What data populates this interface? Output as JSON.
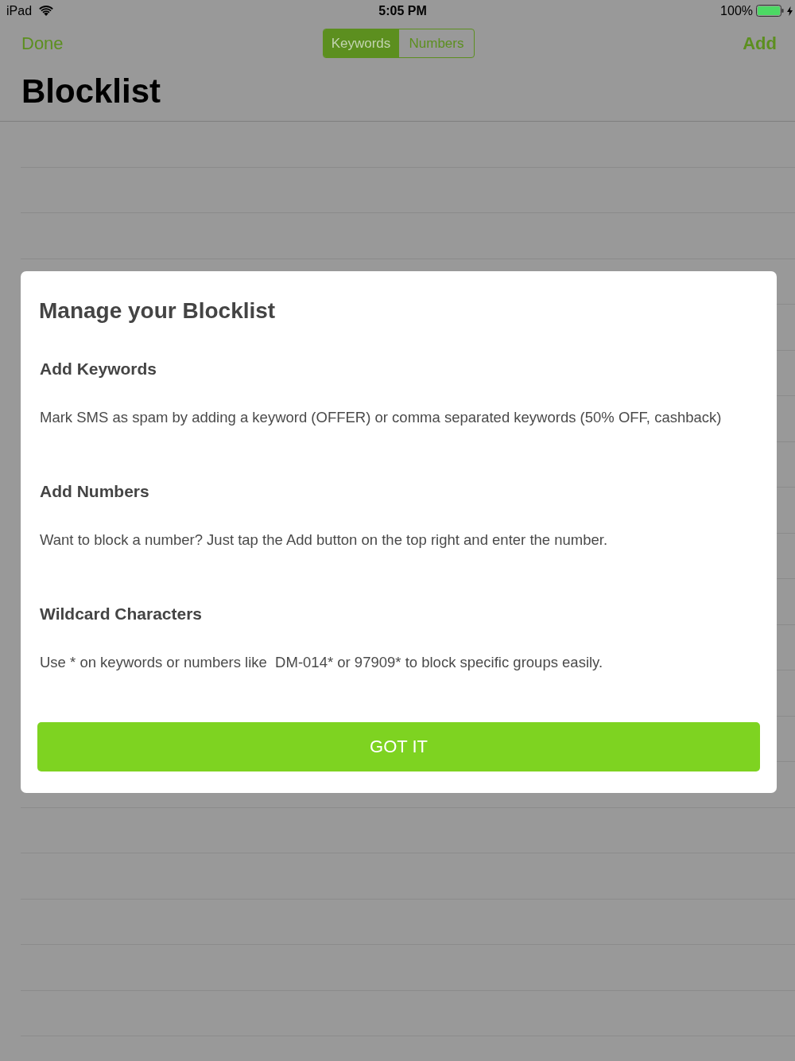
{
  "status_bar": {
    "device": "iPad",
    "time": "5:05 PM",
    "battery": "100%"
  },
  "nav_bar": {
    "left_button": "Done",
    "segments": [
      {
        "label": "Keywords",
        "selected": true
      },
      {
        "label": "Numbers",
        "selected": false
      }
    ],
    "right_button": "Add"
  },
  "title": "Blocklist",
  "dialog": {
    "title": "Manage your Blocklist",
    "sections": [
      {
        "heading": "Add Keywords",
        "body": "Mark SMS as spam by adding a keyword (OFFER) or comma separated keywords (50% OFF, cashback)"
      },
      {
        "heading": "Add Numbers",
        "body": "Want to block a number? Just tap the Add button on the top right and enter the number."
      },
      {
        "heading": "Wildcard Characters",
        "body": "Use * on keywords or numbers like  DM-014* or 97909* to block specific groups easily."
      }
    ],
    "button": "GOT IT"
  }
}
